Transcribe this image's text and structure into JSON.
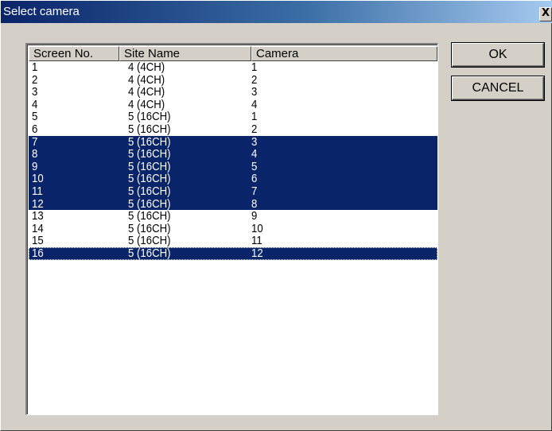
{
  "window": {
    "title": "Select camera",
    "close_glyph": "X"
  },
  "table": {
    "columns": [
      "Screen No.",
      "Site Name",
      "Camera"
    ],
    "rows": [
      {
        "screen": "1",
        "site": "4 (4CH)",
        "camera": "1",
        "selected": false
      },
      {
        "screen": "2",
        "site": "4 (4CH)",
        "camera": "2",
        "selected": false
      },
      {
        "screen": "3",
        "site": "4 (4CH)",
        "camera": "3",
        "selected": false
      },
      {
        "screen": "4",
        "site": "4 (4CH)",
        "camera": "4",
        "selected": false
      },
      {
        "screen": "5",
        "site": "5 (16CH)",
        "camera": "1",
        "selected": false
      },
      {
        "screen": "6",
        "site": "5 (16CH)",
        "camera": "2",
        "selected": false
      },
      {
        "screen": "7",
        "site": "5 (16CH)",
        "camera": "3",
        "selected": true
      },
      {
        "screen": "8",
        "site": "5 (16CH)",
        "camera": "4",
        "selected": true
      },
      {
        "screen": "9",
        "site": "5 (16CH)",
        "camera": "5",
        "selected": true
      },
      {
        "screen": "10",
        "site": "5 (16CH)",
        "camera": "6",
        "selected": true
      },
      {
        "screen": "11",
        "site": "5 (16CH)",
        "camera": "7",
        "selected": true
      },
      {
        "screen": "12",
        "site": "5 (16CH)",
        "camera": "8",
        "selected": true
      },
      {
        "screen": "13",
        "site": "5 (16CH)",
        "camera": "9",
        "selected": false
      },
      {
        "screen": "14",
        "site": "5 (16CH)",
        "camera": "10",
        "selected": false
      },
      {
        "screen": "15",
        "site": "5 (16CH)",
        "camera": "11",
        "selected": false
      },
      {
        "screen": "16",
        "site": "5 (16CH)",
        "camera": "12",
        "selected": true,
        "focused": true
      }
    ]
  },
  "buttons": {
    "ok_label": "OK",
    "cancel_label": "CANCEL"
  },
  "colors": {
    "selection": "#0a246a",
    "dialog_face": "#d4d0c8",
    "title_gradient_start": "#0a246a",
    "title_gradient_end": "#a6caf0"
  }
}
